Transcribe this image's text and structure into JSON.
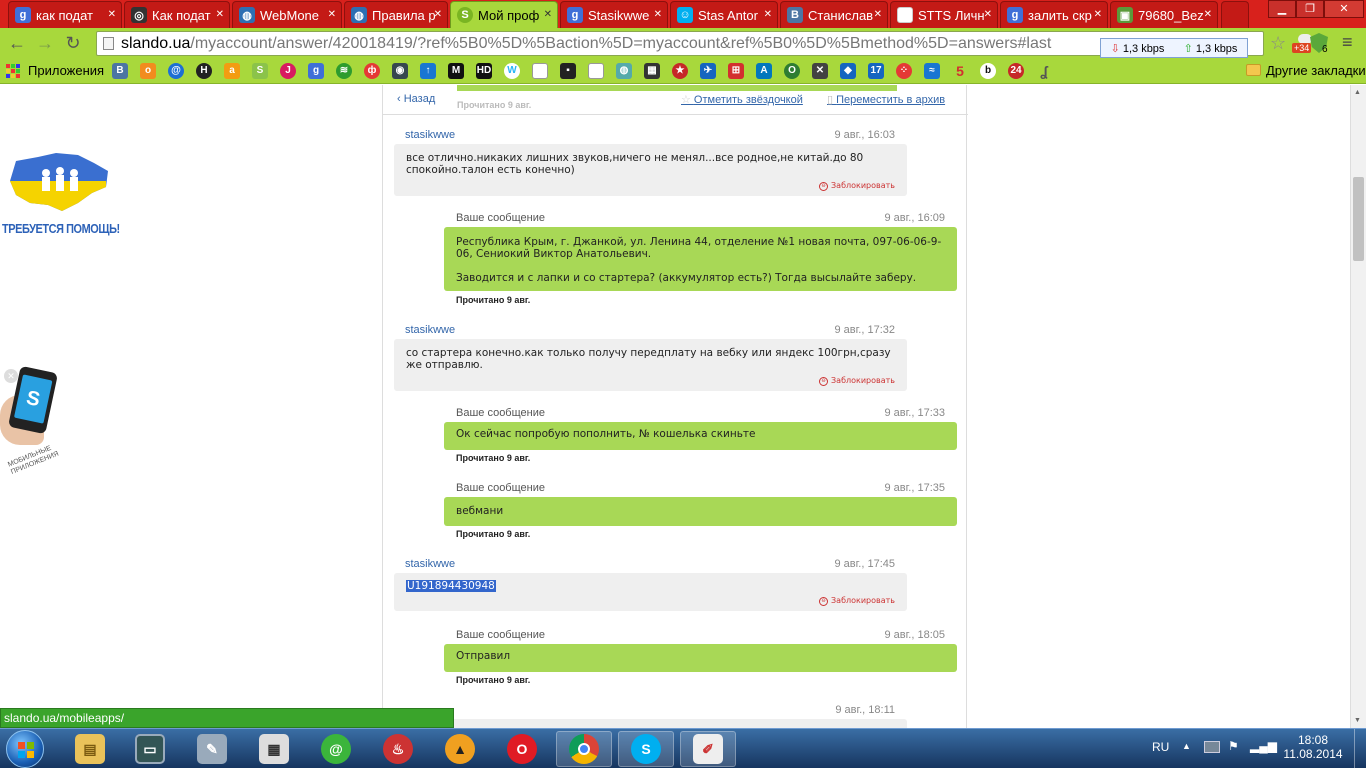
{
  "tabs": [
    {
      "label": "как подат",
      "icon": "google-icon",
      "color": "#3f6fd8"
    },
    {
      "label": "Как подат",
      "icon": "wiki-icon",
      "color": "#444444"
    },
    {
      "label": "WebMone",
      "icon": "globe-icon",
      "color": "#2d6fb3"
    },
    {
      "label": "Правила р",
      "icon": "globe-icon",
      "color": "#2d6fb3"
    },
    {
      "label": "Мой проф",
      "icon": "slando-icon",
      "color": "#7ab522"
    },
    {
      "label": "Stasikwwe",
      "icon": "google-icon",
      "color": "#3f6fd8"
    },
    {
      "label": "Stas Antor",
      "icon": "skype-icon",
      "color": "#00aff0"
    },
    {
      "label": "Станислав",
      "icon": "vk-icon",
      "color": "#4c75a3"
    },
    {
      "label": "STTS Личн",
      "icon": "document-icon",
      "color": "#ffffff"
    },
    {
      "label": "залить скр",
      "icon": "google-icon",
      "color": "#3f6fd8"
    },
    {
      "label": "79680_Bez",
      "icon": "image-icon",
      "color": "#5b9a3a"
    }
  ],
  "url": {
    "host": "slando.ua",
    "path": "/myaccount/answer/420018419/?ref%5B0%5D%5Baction%5D=myaccount&ref%5B0%5D%5Bmethod%5D=answers#last"
  },
  "speed": {
    "down": "1,3 kbps",
    "up": "1,3 kbps"
  },
  "badges": {
    "weather": "+34",
    "adblock": "6"
  },
  "bookmarks": {
    "apps_label": "Приложения",
    "other_label": "Другие закладки"
  },
  "banners": {
    "help_text": "ТРЕБУЕТСЯ ПОМОЩЬ!",
    "mobile_text": "МОБИЛЬНЫЕ ПРИЛОЖЕНИЯ"
  },
  "chat": {
    "back_label": "Назад",
    "star_label": "Отметить звёздочкой",
    "archive_label": "Переместить в архив",
    "read_faded": "Прочитано 9 авг.",
    "block_label": "Заблокировать",
    "read_label": "Прочитано 9 авг.",
    "messages": [
      {
        "from": "stasikwwe",
        "time": "9 авг., 16:03",
        "text": "все отлично.никаких лишних звуков,ничего не менял...все родное,не китай.до 80 спокойно.талон есть конечно)"
      },
      {
        "from": "Ваше сообщение",
        "time": "9 авг., 16:09",
        "text": "Республика Крым, г. Джанкой, ул. Ленина 44, отделение №1 новая почта, 097-06-06-9-06, Сениокий Виктор Анатольевич.",
        "text2": "Заводится и с лапки и со стартера? (аккумулятор есть?) Тогда высылайте заберу."
      },
      {
        "from": "stasikwwe",
        "time": "9 авг., 17:32",
        "text": "со стартера конечно.как только получу передплату на вебку или яндекс 100грн,сразу же отправлю."
      },
      {
        "from": "Ваше сообщение",
        "time": "9 авг., 17:33",
        "text": "Ок сейчас попробую пополнить, № кошелька скиньте"
      },
      {
        "from": "Ваше сообщение",
        "time": "9 авг., 17:35",
        "text": "вебмани"
      },
      {
        "from": "stasikwwe",
        "time": "9 авг., 17:45",
        "text": "U191894430948"
      },
      {
        "from": "Ваше сообщение",
        "time": "9 авг., 18:05",
        "text": "Отправил"
      },
      {
        "from": "",
        "time": "9 авг., 18:11",
        "text": ""
      }
    ]
  },
  "status_url": "slando.ua/mobileapps/",
  "tray": {
    "lang": "RU",
    "time": "18:08",
    "date": "11.08.2014"
  }
}
